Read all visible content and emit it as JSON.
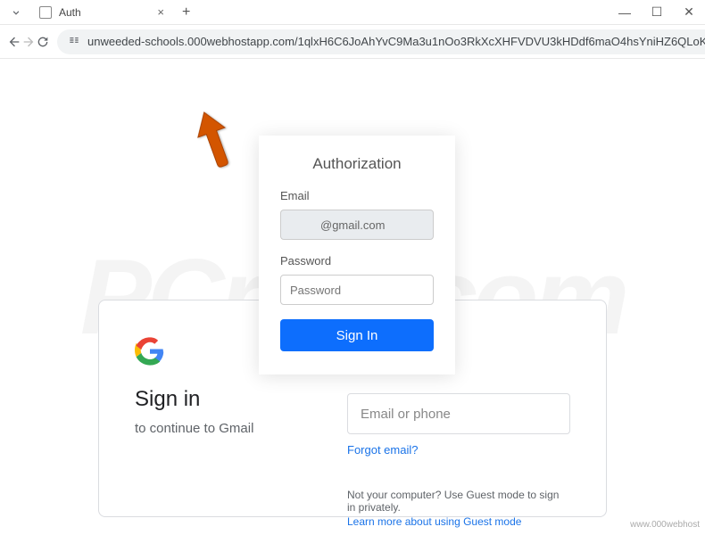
{
  "browser": {
    "tab_title": "Auth",
    "url": "unweeded-schools.000webhostapp.com/1qlxH6C6JoAhYvC9Ma3u1nOo3RkXcXHFVDVU3kHDdf6maO4hsYniHZ6QLoKMW..."
  },
  "auth_modal": {
    "title": "Authorization",
    "email_label": "Email",
    "email_value": "@gmail.com",
    "password_label": "Password",
    "password_placeholder": "Password",
    "signin_label": "Sign In"
  },
  "google_card": {
    "title": "Sign in",
    "subtitle": "to continue to Gmail",
    "input_placeholder": "Email or phone",
    "forgot_link": "Forgot email?",
    "guest_note": "Not your computer? Use Guest mode to sign in privately.",
    "guest_link": "Learn more about using Guest mode"
  },
  "watermark": "PCrisk.com",
  "footer": "www.000webhost"
}
